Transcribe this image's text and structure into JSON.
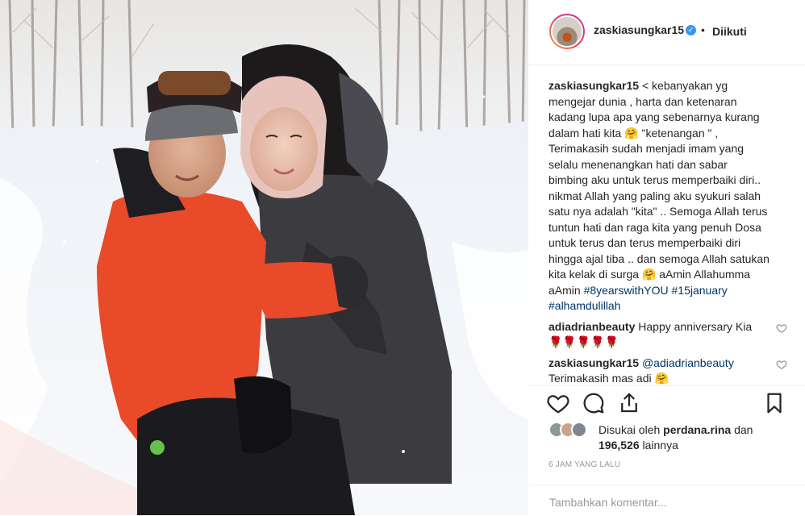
{
  "post": {
    "username": "zaskiasungkar15",
    "verified": true,
    "separator": "•",
    "follow_status": "Diikuti",
    "caption_lines": [
      "< kebanyakan yg",
      "mengejar dunia , harta dan ketenaran",
      "kadang lupa apa yang sebenarnya kurang",
      "dalam hati kita 🤗 \"ketenangan \" ,",
      "Terimakasih sudah menjadi imam yang",
      "selalu menenangkan hati dan sabar",
      "bimbing aku untuk terus memperbaiki diri..",
      "nikmat Allah yang paling aku syukuri salah",
      "satu nya adalah \"kita\" .. Semoga Allah terus",
      "tuntun hati dan raga kita yang penuh Dosa",
      "untuk terus dan terus memperbaiki diri",
      "hingga ajal tiba .. dan semoga Allah satukan",
      "kita kelak di surga 🤗 aAmin Allahumma",
      "aAmin"
    ],
    "hashtags": [
      "#8yearswithYOU",
      "#15january",
      "#alhamdulillah"
    ],
    "comments": [
      {
        "user": "adiadrianbeauty",
        "text": "Happy anniversary Kia",
        "text2": "🌹🌹🌹🌹🌹"
      },
      {
        "user": "zaskiasungkar15",
        "mention": "@adiadrianbeauty",
        "text2": "Terimakasih mas adi 🤗"
      }
    ],
    "likes": {
      "prefix": "Disukai oleh ",
      "liker": "perdana.rina",
      "middle": " dan",
      "count": "196,526",
      "suffix": " lainnya"
    },
    "timestamp": "6 JAM YANG LALU",
    "comment_placeholder": "Tambahkan komentar..."
  },
  "icons": {
    "like": "heart-icon",
    "comment": "comment-icon",
    "share": "share-icon",
    "save": "bookmark-icon",
    "verified": "verified-badge-icon"
  },
  "colors": {
    "text": "#262626",
    "secondary": "#999999",
    "link": "#003569",
    "verified": "#3897f0",
    "jacket": "#e84a2a"
  }
}
